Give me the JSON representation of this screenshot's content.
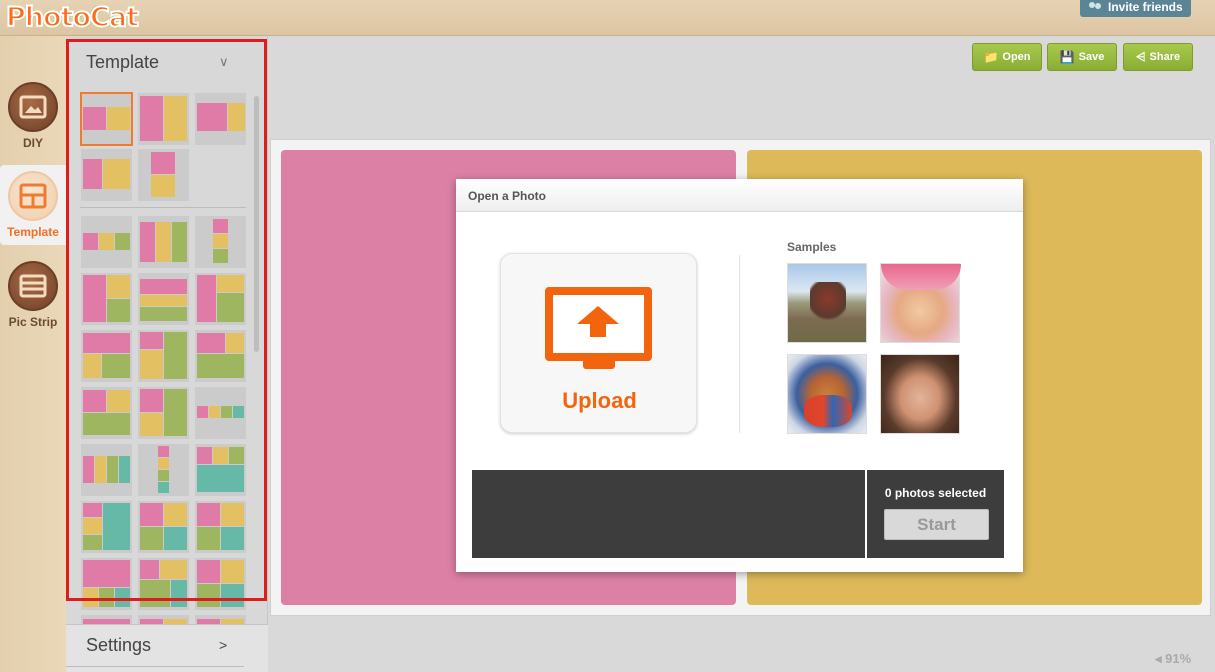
{
  "app": {
    "logo_text": "PhotoCat",
    "invite_label": "Invite friends",
    "colors": {
      "accent": "#f2650e",
      "green": "#8fb23a",
      "pink": "#dc80a5",
      "yellow": "#ddb95a"
    }
  },
  "leftnav": {
    "items": [
      {
        "label": "DIY",
        "icon": "photo-frame-icon"
      },
      {
        "label": "Template",
        "icon": "template-layout-icon",
        "active": true
      },
      {
        "label": "Pic Strip",
        "icon": "pic-strip-icon"
      }
    ]
  },
  "panel": {
    "title": "Template",
    "collapse_icon": "chevron-down-icon",
    "settings_label": "Settings",
    "settings_arrow": ">"
  },
  "toolbar": {
    "open_label": "Open",
    "save_label": "Save",
    "share_label": "Share"
  },
  "dialog": {
    "title": "Open a Photo",
    "upload_label": "Upload",
    "samples_label": "Samples",
    "selected_text": "0 photos selected",
    "start_label": "Start"
  },
  "status": {
    "zoom": "91%"
  }
}
